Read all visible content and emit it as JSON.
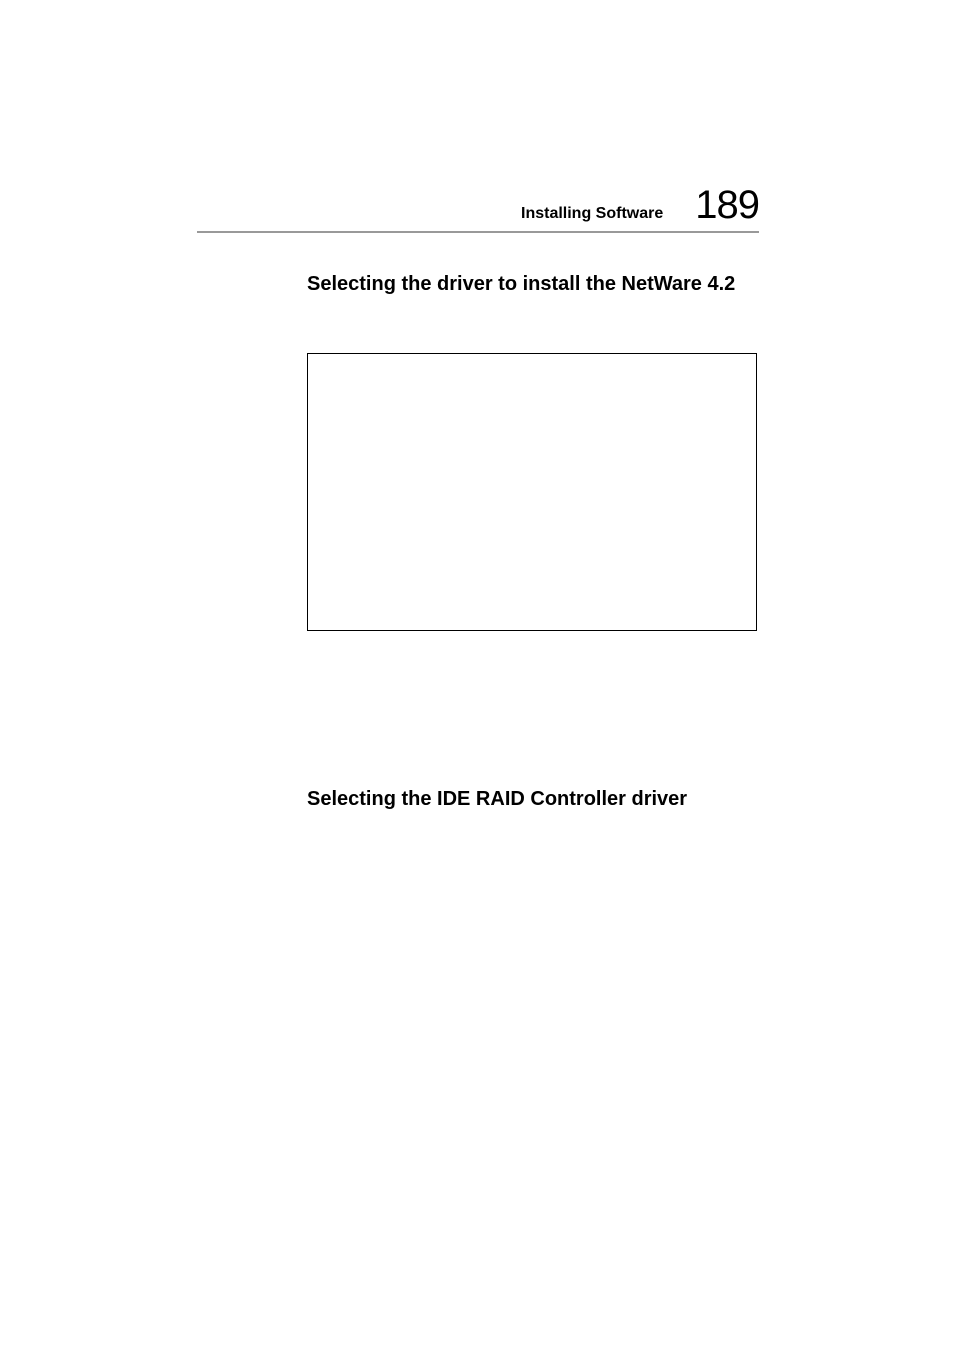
{
  "header": {
    "section_label": "Installing Software",
    "page_number": "189"
  },
  "headings": {
    "section_1": "Selecting the driver to install the NetWare 4.2",
    "section_2": "Selecting the IDE RAID Controller driver"
  }
}
